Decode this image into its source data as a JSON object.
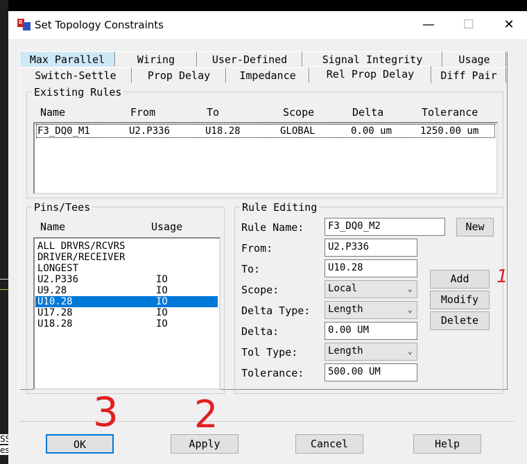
{
  "window": {
    "title": "Set Topology Constraints",
    "minimize_label": "—",
    "maximize_label": "☐",
    "close_label": "✕"
  },
  "tabs_row1": [
    "Max Parallel",
    "Wiring",
    "User-Defined",
    "Signal Integrity",
    "Usage"
  ],
  "tabs_row2": [
    "Switch-Settle",
    "Prop Delay",
    "Impedance",
    "Rel Prop Delay",
    "Diff Pair"
  ],
  "existing_rules": {
    "group_label": "Existing Rules",
    "columns": [
      "Name",
      "From",
      "To",
      "Scope",
      "Delta",
      "Tolerance"
    ],
    "rows": [
      {
        "name": "F3_DQ0_M1",
        "from": "U2.P336",
        "to": "U18.28",
        "scope": "GLOBAL",
        "delta": "0.00 um",
        "tolerance": "1250.00 um"
      }
    ]
  },
  "pins_tees": {
    "group_label": "Pins/Tees",
    "columns": [
      "Name",
      "Usage"
    ],
    "items": [
      {
        "name": "ALL DRVRS/RCVRS",
        "usage": ""
      },
      {
        "name": "DRIVER/RECEIVER",
        "usage": ""
      },
      {
        "name": "LONGEST",
        "usage": ""
      },
      {
        "name": "U2.P336",
        "usage": "IO"
      },
      {
        "name": "U9.28",
        "usage": "IO"
      },
      {
        "name": "U10.28",
        "usage": "IO"
      },
      {
        "name": "U17.28",
        "usage": "IO"
      },
      {
        "name": "U18.28",
        "usage": "IO"
      }
    ]
  },
  "rule_editing": {
    "group_label": "Rule Editing",
    "rule_name_label": "Rule Name:",
    "rule_name": "F3_DQ0_M2",
    "from_label": "From:",
    "from": "U2.P336",
    "to_label": "To:",
    "to": "U10.28",
    "scope_label": "Scope:",
    "scope": "Local",
    "delta_type_label": "Delta Type:",
    "delta_type": "Length",
    "delta_label": "Delta:",
    "delta": "0.00 UM",
    "tol_type_label": "Tol Type:",
    "tol_type": "Length",
    "tolerance_label": "Tolerance:",
    "tolerance": "500.00 UM",
    "new_button": "New",
    "add_button": "Add",
    "modify_button": "Modify",
    "delete_button": "Delete"
  },
  "footer": {
    "ok": "OK",
    "apply": "Apply",
    "cancel": "Cancel",
    "help": "Help"
  },
  "annotations": {
    "mark_1": "1",
    "mark_2": "2",
    "mark_3": "3"
  },
  "background_text": {
    "edge_1": "SSI",
    "edge_2": "es"
  }
}
